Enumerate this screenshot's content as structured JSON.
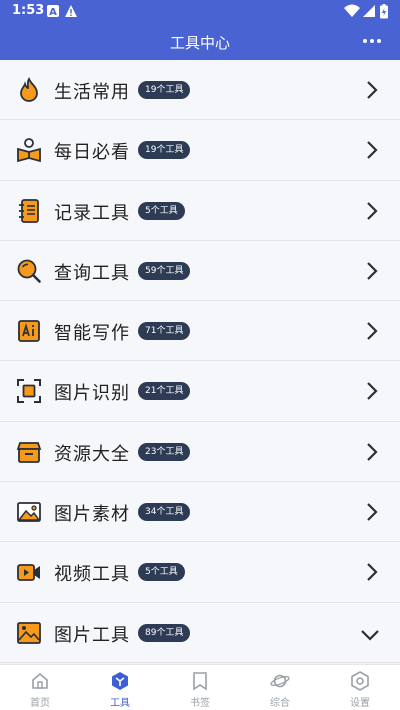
{
  "status_bar": {
    "time": "1:53"
  },
  "app_bar": {
    "title": "工具中心"
  },
  "categories": [
    {
      "label": "生活常用",
      "count": "19个工具",
      "icon": "flame-icon"
    },
    {
      "label": "每日必看",
      "count": "19个工具",
      "icon": "reading-icon"
    },
    {
      "label": "记录工具",
      "count": "5个工具",
      "icon": "notebook-icon"
    },
    {
      "label": "查询工具",
      "count": "59个工具",
      "icon": "magnifier-icon"
    },
    {
      "label": "智能写作",
      "count": "71个工具",
      "icon": "ai-icon"
    },
    {
      "label": "图片识别",
      "count": "21个工具",
      "icon": "scan-icon"
    },
    {
      "label": "资源大全",
      "count": "23个工具",
      "icon": "box-icon"
    },
    {
      "label": "图片素材",
      "count": "34个工具",
      "icon": "image-icon"
    },
    {
      "label": "视频工具",
      "count": "5个工具",
      "icon": "video-camera-icon"
    },
    {
      "label": "图片工具",
      "count": "89个工具",
      "icon": "picture-icon",
      "expanded": true
    }
  ],
  "tabs": [
    {
      "label": "首页",
      "icon": "home-icon"
    },
    {
      "label": "工具",
      "icon": "tools-icon",
      "active": true
    },
    {
      "label": "书签",
      "icon": "bookmark-icon"
    },
    {
      "label": "综合",
      "icon": "planet-icon"
    },
    {
      "label": "设置",
      "icon": "gear-icon"
    }
  ],
  "colors": {
    "primary": "#4a63d3",
    "badge": "#2d3b55",
    "icon_orange": "#f59a1b",
    "icon_dark": "#2b2f3a",
    "tab_active": "#3d5fd6"
  }
}
